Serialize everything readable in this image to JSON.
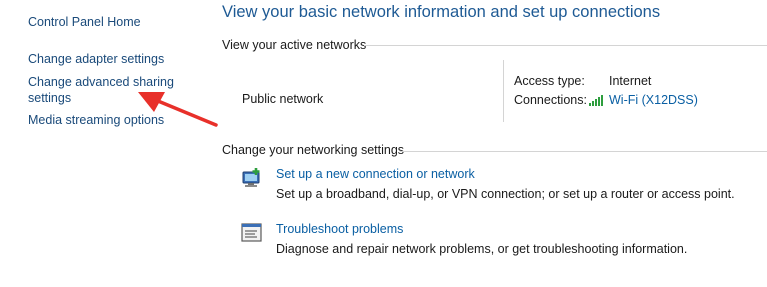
{
  "sidebar": {
    "items": [
      {
        "label": "Control Panel Home"
      },
      {
        "label": "Change adapter settings"
      },
      {
        "label_line1": "Change advanced sharing",
        "label_line2": "settings"
      },
      {
        "label": "Media streaming options"
      }
    ]
  },
  "main": {
    "title": "View your basic network information and set up connections",
    "active_networks": {
      "heading": "View your active networks",
      "network_name": "Public network",
      "access_type_label": "Access type:",
      "access_type_value": "Internet",
      "connections_label": "Connections:",
      "connections_value": "Wi-Fi (X12DSS)"
    },
    "settings": {
      "heading": "Change your networking settings",
      "tasks": [
        {
          "icon": "new-connection-icon",
          "link": "Set up a new connection or network",
          "description": "Set up a broadband, dial-up, or VPN connection; or set up a router or access point."
        },
        {
          "icon": "troubleshoot-icon",
          "link": "Troubleshoot problems",
          "description": "Diagnose and repair network problems, or get troubleshooting information."
        }
      ]
    }
  },
  "colors": {
    "title": "#1e5a94",
    "link": "#0a5fa3",
    "annotation_arrow": "#e8302a",
    "wifi_signal": "#2e9e3e"
  }
}
